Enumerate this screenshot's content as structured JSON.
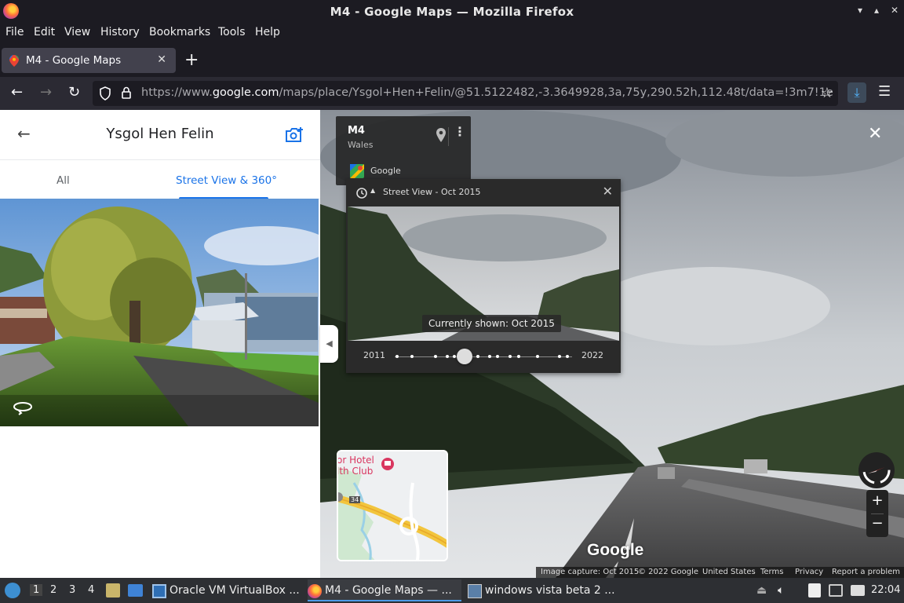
{
  "window": {
    "title": "M4 - Google Maps — Mozilla Firefox",
    "controls": [
      "minimize",
      "maximize",
      "close"
    ]
  },
  "menubar": {
    "items": [
      "File",
      "Edit",
      "View",
      "History",
      "Bookmarks",
      "Tools",
      "Help"
    ]
  },
  "tabs": [
    {
      "label": "M4 - Google Maps",
      "icon": "google-maps-icon",
      "active": true
    }
  ],
  "navbar": {
    "url_prefix": "https://www.",
    "url_domain": "google.com",
    "url_rest": "/maps/place/Ysgol+Hen+Felin/@51.5122482,-3.3649928,3a,75y,290.52h,112.48t/data=!3m7!1e"
  },
  "left_panel": {
    "title": "Ysgol Hen Felin",
    "tabs": [
      {
        "label": "All",
        "active": false
      },
      {
        "label": "Street View & 360°",
        "active": true
      }
    ]
  },
  "info_card": {
    "road": "M4",
    "region": "Wales",
    "source": "Google"
  },
  "time_machine": {
    "title": "Street View - Oct 2015",
    "currently_shown": "Currently shown: Oct 2015",
    "year_start": "2011",
    "year_end": "2022"
  },
  "minimap": {
    "place_label_line1": "or Hotel",
    "place_label_line2": "lth Club",
    "road_number": "34"
  },
  "watermark": "Google",
  "footer": {
    "image_capture": "Image capture: Oct 2015",
    "copyright": "© 2022 Google",
    "country": "United States",
    "terms": "Terms",
    "privacy": "Privacy",
    "report": "Report a problem"
  },
  "taskbar": {
    "workspaces": [
      "1",
      "2",
      "3",
      "4"
    ],
    "apps": [
      {
        "label": "Oracle VM VirtualBox ...",
        "icon": "virtualbox-icon",
        "active": false
      },
      {
        "label": "M4 - Google Maps — ...",
        "icon": "firefox-icon",
        "active": true
      },
      {
        "label": "windows vista beta 2 ...",
        "icon": "vista-icon",
        "active": false
      }
    ],
    "clock": "22:04"
  }
}
